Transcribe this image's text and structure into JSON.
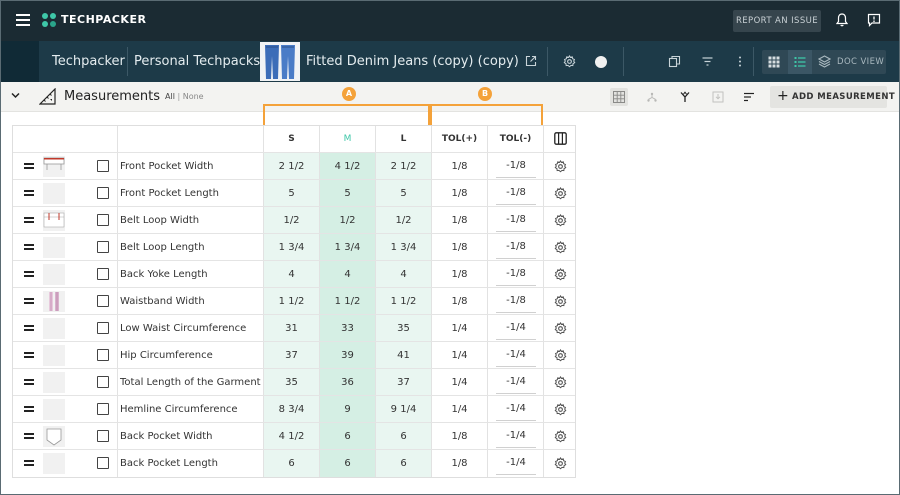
{
  "app": {
    "logo_text": "TECHPACKER",
    "report_issue_label": "REPORT AN ISSUE"
  },
  "breadcrumb": {
    "root": "Techpacker",
    "section": "Personal Techpacks",
    "product": "Fitted Denim Jeans (copy) (copy)"
  },
  "view": {
    "doc_view_label": "DOC VIEW"
  },
  "toolbar": {
    "title": "Measurements",
    "filter_all": "All",
    "filter_sep": "|",
    "filter_none": "None",
    "add_label": "ADD MEASUREMENT"
  },
  "annotations": {
    "a": "A",
    "b": "B"
  },
  "table": {
    "headers": {
      "s": "S",
      "m": "M",
      "l": "L",
      "tol_plus": "TOL(+)",
      "tol_minus": "TOL(-)"
    },
    "rows": [
      {
        "name": "Front Pocket Width",
        "s": "2 1/2",
        "m": "4 1/2",
        "l": "2 1/2",
        "tp": "1/8",
        "tm": "-1/8"
      },
      {
        "name": "Front Pocket Length",
        "s": "5",
        "m": "5",
        "l": "5",
        "tp": "1/8",
        "tm": "-1/8"
      },
      {
        "name": "Belt Loop Width",
        "s": "1/2",
        "m": "1/2",
        "l": "1/2",
        "tp": "1/8",
        "tm": "-1/8"
      },
      {
        "name": "Belt Loop Length",
        "s": "1 3/4",
        "m": "1 3/4",
        "l": "1 3/4",
        "tp": "1/8",
        "tm": "-1/8"
      },
      {
        "name": "Back Yoke Length",
        "s": "4",
        "m": "4",
        "l": "4",
        "tp": "1/8",
        "tm": "-1/8"
      },
      {
        "name": "Waistband Width",
        "s": "1 1/2",
        "m": "1 1/2",
        "l": "1 1/2",
        "tp": "1/8",
        "tm": "-1/8"
      },
      {
        "name": "Low Waist Circumference",
        "s": "31",
        "m": "33",
        "l": "35",
        "tp": "1/4",
        "tm": "-1/4"
      },
      {
        "name": "Hip Circumference",
        "s": "37",
        "m": "39",
        "l": "41",
        "tp": "1/4",
        "tm": "-1/4"
      },
      {
        "name": "Total Length of the Garment",
        "s": "35",
        "m": "36",
        "l": "37",
        "tp": "1/4",
        "tm": "-1/4"
      },
      {
        "name": "Hemline Circumference",
        "s": "8 3/4",
        "m": "9",
        "l": "9 1/4",
        "tp": "1/4",
        "tm": "-1/4"
      },
      {
        "name": "Back Pocket Width",
        "s": "4 1/2",
        "m": "6",
        "l": "6",
        "tp": "1/8",
        "tm": "-1/4"
      },
      {
        "name": "Back Pocket Length",
        "s": "6",
        "m": "6",
        "l": "6",
        "tp": "1/8",
        "tm": "-1/4"
      }
    ]
  },
  "colors": {
    "topbar": "#1b2b33",
    "subbar": "#1d3a48",
    "accent": "#3ec7a8",
    "annotation": "#f4a23a",
    "size_cell": "#e9f6f1",
    "size_cell_m": "#d5efe4"
  }
}
